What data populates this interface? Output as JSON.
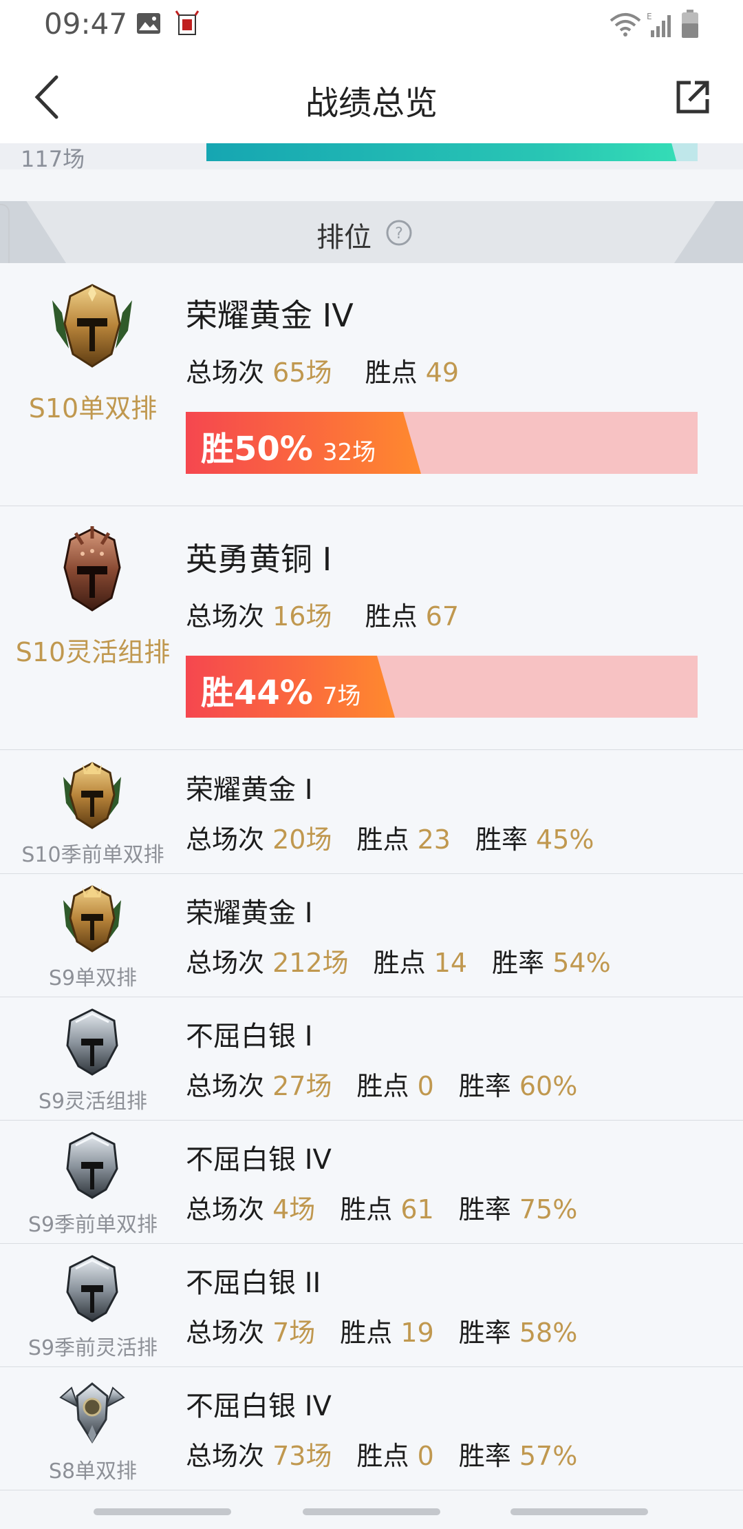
{
  "status_bar": {
    "time": "09:47"
  },
  "header": {
    "title": "战绩总览"
  },
  "summary": {
    "total_games": "117场"
  },
  "section": {
    "title": "排位"
  },
  "labels": {
    "total": "总场次",
    "lp": "胜点",
    "wr": "胜率"
  },
  "cards": [
    {
      "queue": "S10单双排",
      "tier": "荣耀黄金 IV",
      "games": "65场",
      "lp": "49",
      "win_rate_text": "胜50%",
      "win_rate": 0.5,
      "wins": "32场"
    },
    {
      "queue": "S10灵活组排",
      "tier": "英勇黄铜 I",
      "games": "16场",
      "lp": "67",
      "win_rate_text": "胜44%",
      "win_rate": 0.44,
      "wins": "7场"
    }
  ],
  "rows": [
    {
      "queue": "S10季前单双排",
      "tier": "荣耀黄金 I",
      "games": "20场",
      "lp": "23",
      "wr": "45%",
      "emblem": "gold"
    },
    {
      "queue": "S9单双排",
      "tier": "荣耀黄金 I",
      "games": "212场",
      "lp": "14",
      "wr": "54%",
      "emblem": "gold"
    },
    {
      "queue": "S9灵活组排",
      "tier": "不屈白银 I",
      "games": "27场",
      "lp": "0",
      "wr": "60%",
      "emblem": "silver"
    },
    {
      "queue": "S9季前单双排",
      "tier": "不屈白银 IV",
      "games": "4场",
      "lp": "61",
      "wr": "75%",
      "emblem": "silver"
    },
    {
      "queue": "S9季前灵活排",
      "tier": "不屈白银 II",
      "games": "7场",
      "lp": "19",
      "wr": "58%",
      "emblem": "silver"
    },
    {
      "queue": "S8单双排",
      "tier": "不屈白银 IV",
      "games": "73场",
      "lp": "0",
      "wr": "57%",
      "emblem": "silver-old"
    }
  ]
}
